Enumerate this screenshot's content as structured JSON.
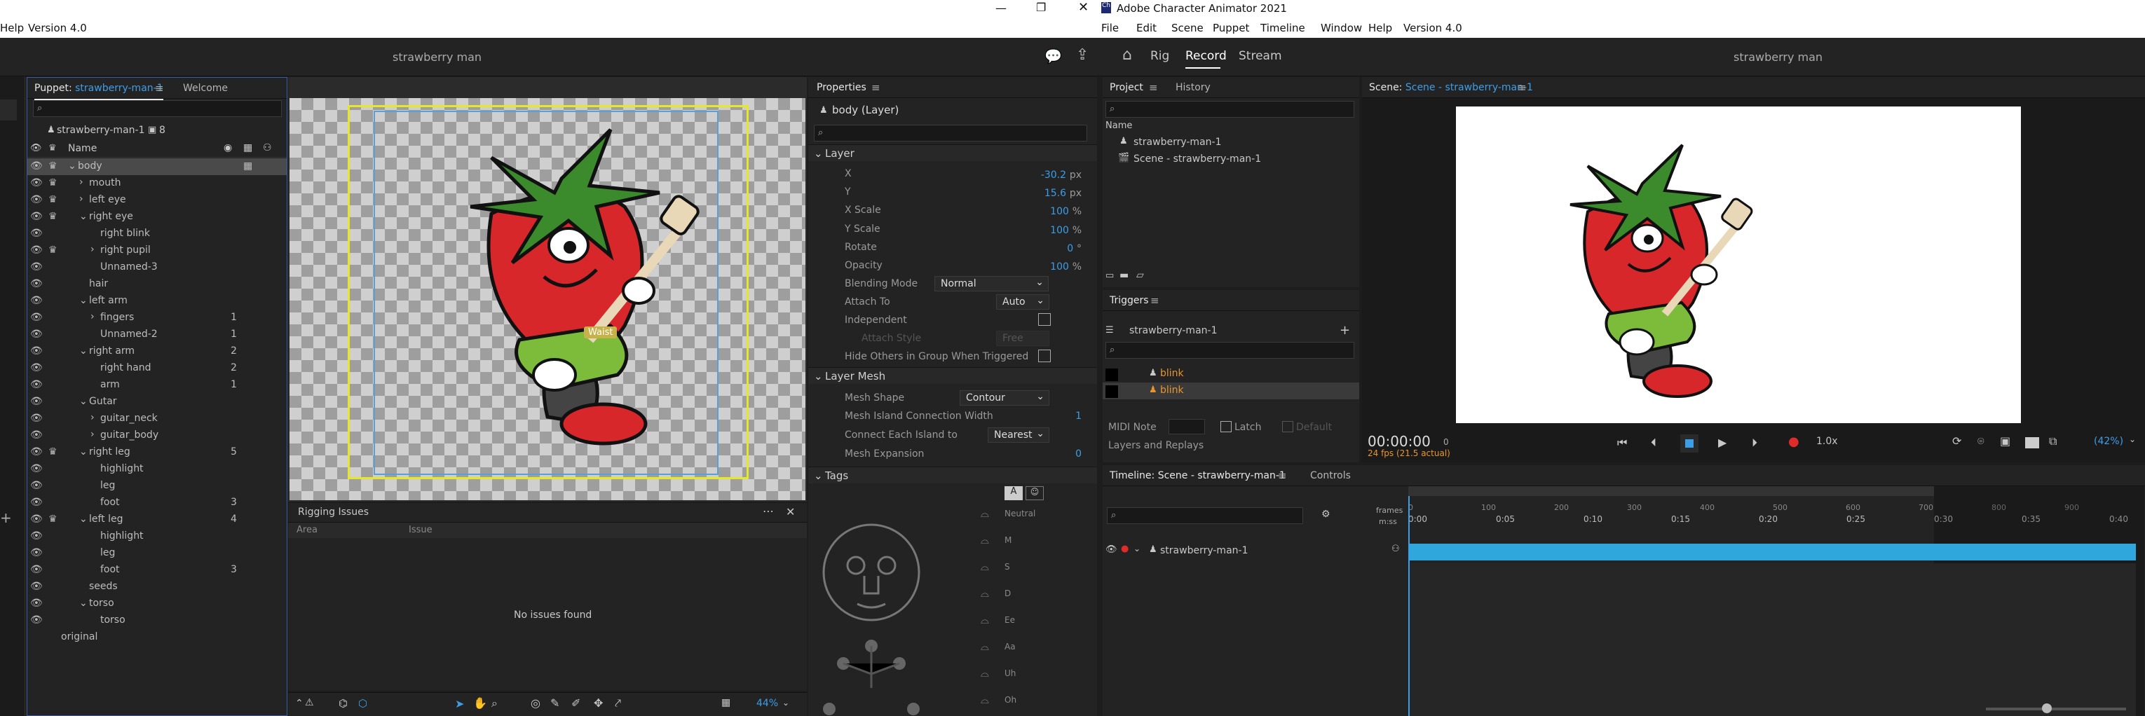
{
  "left_window": {
    "menu": {
      "help": "Help",
      "version": "Version 4.0"
    },
    "doc_title": "strawberry man",
    "puppet_panel": {
      "tab_puppet_prefix": "Puppet:",
      "tab_puppet_name": "strawberry-man-1",
      "tab_welcome": "Welcome",
      "puppet_name": "strawberry-man-1",
      "puppet_count": "8",
      "name_header": "Name",
      "layers": [
        {
          "label": "body",
          "indent": 0,
          "num": "",
          "crown": true,
          "eye": true,
          "expand": "v",
          "selected": true
        },
        {
          "label": "mouth",
          "indent": 1,
          "num": "",
          "crown": true,
          "eye": true,
          "expand": ">"
        },
        {
          "label": "left eye",
          "indent": 1,
          "num": "",
          "crown": true,
          "eye": true,
          "expand": ">"
        },
        {
          "label": "right eye",
          "indent": 1,
          "num": "",
          "crown": true,
          "eye": true,
          "expand": "v"
        },
        {
          "label": "right blink",
          "indent": 2,
          "num": "",
          "crown": false,
          "eye": true,
          "expand": ""
        },
        {
          "label": "right pupil",
          "indent": 2,
          "num": "",
          "crown": true,
          "eye": true,
          "expand": ">"
        },
        {
          "label": "Unnamed-3",
          "indent": 2,
          "num": "",
          "crown": false,
          "eye": true,
          "expand": ""
        },
        {
          "label": "hair",
          "indent": 1,
          "num": "",
          "crown": false,
          "eye": true,
          "expand": ""
        },
        {
          "label": "left arm",
          "indent": 1,
          "num": "",
          "crown": false,
          "eye": true,
          "expand": "v"
        },
        {
          "label": "fingers",
          "indent": 2,
          "num": "1",
          "crown": false,
          "eye": true,
          "expand": ">"
        },
        {
          "label": "Unnamed-2",
          "indent": 2,
          "num": "1",
          "crown": false,
          "eye": true,
          "expand": ""
        },
        {
          "label": "right arm",
          "indent": 1,
          "num": "2",
          "crown": false,
          "eye": true,
          "expand": "v"
        },
        {
          "label": "right hand",
          "indent": 2,
          "num": "2",
          "crown": false,
          "eye": true,
          "expand": ""
        },
        {
          "label": "arm",
          "indent": 2,
          "num": "1",
          "crown": false,
          "eye": true,
          "expand": ""
        },
        {
          "label": "Gutar",
          "indent": 1,
          "num": "",
          "crown": false,
          "eye": true,
          "expand": "v"
        },
        {
          "label": "guitar_neck",
          "indent": 2,
          "num": "",
          "crown": false,
          "eye": true,
          "expand": ">"
        },
        {
          "label": "guitar_body",
          "indent": 2,
          "num": "",
          "crown": false,
          "eye": true,
          "expand": ">"
        },
        {
          "label": "right leg",
          "indent": 1,
          "num": "5",
          "crown": true,
          "eye": true,
          "expand": "v"
        },
        {
          "label": "highlight",
          "indent": 2,
          "num": "",
          "crown": false,
          "eye": true,
          "expand": ""
        },
        {
          "label": "leg",
          "indent": 2,
          "num": "",
          "crown": false,
          "eye": true,
          "expand": ""
        },
        {
          "label": "foot",
          "indent": 2,
          "num": "3",
          "crown": false,
          "eye": true,
          "expand": ""
        },
        {
          "label": "left leg",
          "indent": 1,
          "num": "4",
          "crown": true,
          "eye": true,
          "expand": "v"
        },
        {
          "label": "highlight",
          "indent": 2,
          "num": "",
          "crown": false,
          "eye": true,
          "expand": ""
        },
        {
          "label": "leg",
          "indent": 2,
          "num": "",
          "crown": false,
          "eye": true,
          "expand": ""
        },
        {
          "label": "foot",
          "indent": 2,
          "num": "3",
          "crown": false,
          "eye": true,
          "expand": ""
        },
        {
          "label": "seeds",
          "indent": 1,
          "num": "",
          "crown": false,
          "eye": true,
          "expand": ""
        },
        {
          "label": "torso",
          "indent": 1,
          "num": "",
          "crown": false,
          "eye": true,
          "expand": "v"
        },
        {
          "label": "torso",
          "indent": 2,
          "num": "",
          "crown": false,
          "eye": true,
          "expand": ""
        },
        {
          "label": "original",
          "indent": 0,
          "num": "",
          "crown": false,
          "eye": false,
          "expand": ""
        }
      ]
    },
    "canvas": {
      "handle_label": "Waist",
      "zoom": "44%"
    },
    "rigging": {
      "title": "Rigging Issues",
      "col_area": "Area",
      "col_issue": "Issue",
      "empty": "No issues found"
    },
    "properties": {
      "title": "Properties",
      "layer_name": "body (Layer)",
      "section_layer": "Layer",
      "x_label": "X",
      "x_value": "-30.2",
      "x_unit": "px",
      "y_label": "Y",
      "y_value": "15.6",
      "y_unit": "px",
      "xscale_label": "X Scale",
      "xscale_value": "100",
      "xscale_unit": "%",
      "yscale_label": "Y Scale",
      "yscale_value": "100",
      "yscale_unit": "%",
      "rotate_label": "Rotate",
      "rotate_value": "0",
      "rotate_unit": "°",
      "opacity_label": "Opacity",
      "opacity_value": "100",
      "opacity_unit": "%",
      "blend_label": "Blending Mode",
      "blend_value": "Normal",
      "attach_label": "Attach To",
      "attach_value": "Auto",
      "independent_label": "Independent",
      "attach_style_label": "Attach Style",
      "attach_style_value": "Free",
      "hide_others_label": "Hide Others in Group When Triggered",
      "section_mesh": "Layer Mesh",
      "mesh_shape_label": "Mesh Shape",
      "mesh_shape_value": "Contour",
      "mesh_island_label": "Mesh Island Connection Width",
      "mesh_island_value": "1",
      "connect_label": "Connect Each Island to",
      "connect_value": "Nearest",
      "mesh_exp_label": "Mesh Expansion",
      "mesh_exp_value": "0",
      "section_tags": "Tags",
      "tag_labels": [
        "Neutral",
        "M",
        "S",
        "D",
        "Ee",
        "Aa",
        "Uh",
        "Oh"
      ]
    }
  },
  "right_window": {
    "app_title": "Adobe Character Animator 2021",
    "menu": [
      "File",
      "Edit",
      "Scene",
      "Puppet",
      "Timeline",
      "Window",
      "Help",
      "Version 4.0"
    ],
    "mode_tabs": [
      "Rig",
      "Record",
      "Stream"
    ],
    "active_mode": "Record",
    "doc_title": "strawberry man",
    "project": {
      "tab": "Project",
      "tab_history": "History",
      "name_header": "Name",
      "items": [
        "strawberry-man-1",
        "Scene - strawberry-man-1"
      ]
    },
    "triggers": {
      "title": "Triggers",
      "puppet": "strawberry-man-1",
      "items": [
        "blink",
        "blink"
      ]
    },
    "midi": {
      "label": "MIDI Note",
      "latch": "Latch",
      "default": "Default",
      "layers_replays": "Layers and Replays"
    },
    "scene": {
      "tab_prefix": "Scene:",
      "tab_name": "Scene - strawberry-man-1",
      "timecode": "00:00:00",
      "frame": "0",
      "fps": "24 fps (21.5 actual)",
      "speed": "1.0x",
      "zoom": "(42%)"
    },
    "timeline": {
      "tab": "Timeline: Scene - strawberry-man-1",
      "tab_controls": "Controls",
      "frames_label": "frames",
      "mss_label": "m:ss",
      "frame_ticks": [
        "0",
        "100",
        "200",
        "300",
        "400",
        "500",
        "600",
        "700",
        "800",
        "900"
      ],
      "time_ticks": [
        "0:00",
        "0:05",
        "0:10",
        "0:15",
        "0:20",
        "0:25",
        "0:30",
        "0:35",
        "0:40"
      ],
      "track_name": "strawberry-man-1"
    }
  },
  "colors": {
    "accent_blue": "#3d9ee8",
    "track_blue": "#2fa6dc",
    "trigger_orange": "#e9952e",
    "bounds_yellow": "#e6e62a"
  }
}
